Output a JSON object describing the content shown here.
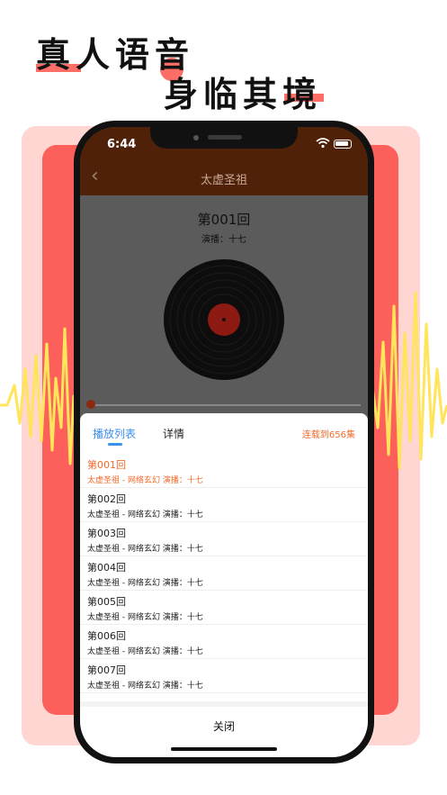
{
  "promo": {
    "headline_1": "真人语音",
    "headline_2": "身临其境"
  },
  "status_bar": {
    "time": "6:44"
  },
  "nav": {
    "back_icon": "chevron-left-icon",
    "title": "太虚圣祖"
  },
  "player": {
    "episode_title": "第001回",
    "narrator": "演播：十七",
    "vinyl_label": "黑胶",
    "progress": 0.0
  },
  "sheet": {
    "tabs": [
      {
        "label": "播放列表",
        "active": true
      },
      {
        "label": "详情",
        "active": false
      }
    ],
    "serial_status": "连载到656集",
    "episodes": [
      {
        "title": "第001回",
        "subtitle": "太虚圣祖 - 网络玄幻   演播：十七",
        "current": true
      },
      {
        "title": "第002回",
        "subtitle": "太虚圣祖 - 网络玄幻   演播：十七",
        "current": false
      },
      {
        "title": "第003回",
        "subtitle": "太虚圣祖 - 网络玄幻   演播：十七",
        "current": false
      },
      {
        "title": "第004回",
        "subtitle": "太虚圣祖 - 网络玄幻   演播：十七",
        "current": false
      },
      {
        "title": "第005回",
        "subtitle": "太虚圣祖 - 网络玄幻   演播：十七",
        "current": false
      },
      {
        "title": "第006回",
        "subtitle": "太虚圣祖 - 网络玄幻   演播：十七",
        "current": false
      },
      {
        "title": "第007回",
        "subtitle": "太虚圣祖 - 网络玄幻   演播：十七",
        "current": false
      }
    ],
    "close_label": "关闭"
  },
  "colors": {
    "accent_orange": "#f36a2c",
    "tab_blue": "#3a8ff0",
    "brand_red": "#fd5f5a",
    "pink_bg": "#ffd6d2",
    "header_brown": "#4f2109",
    "wave_yellow": "#ffe45c"
  }
}
